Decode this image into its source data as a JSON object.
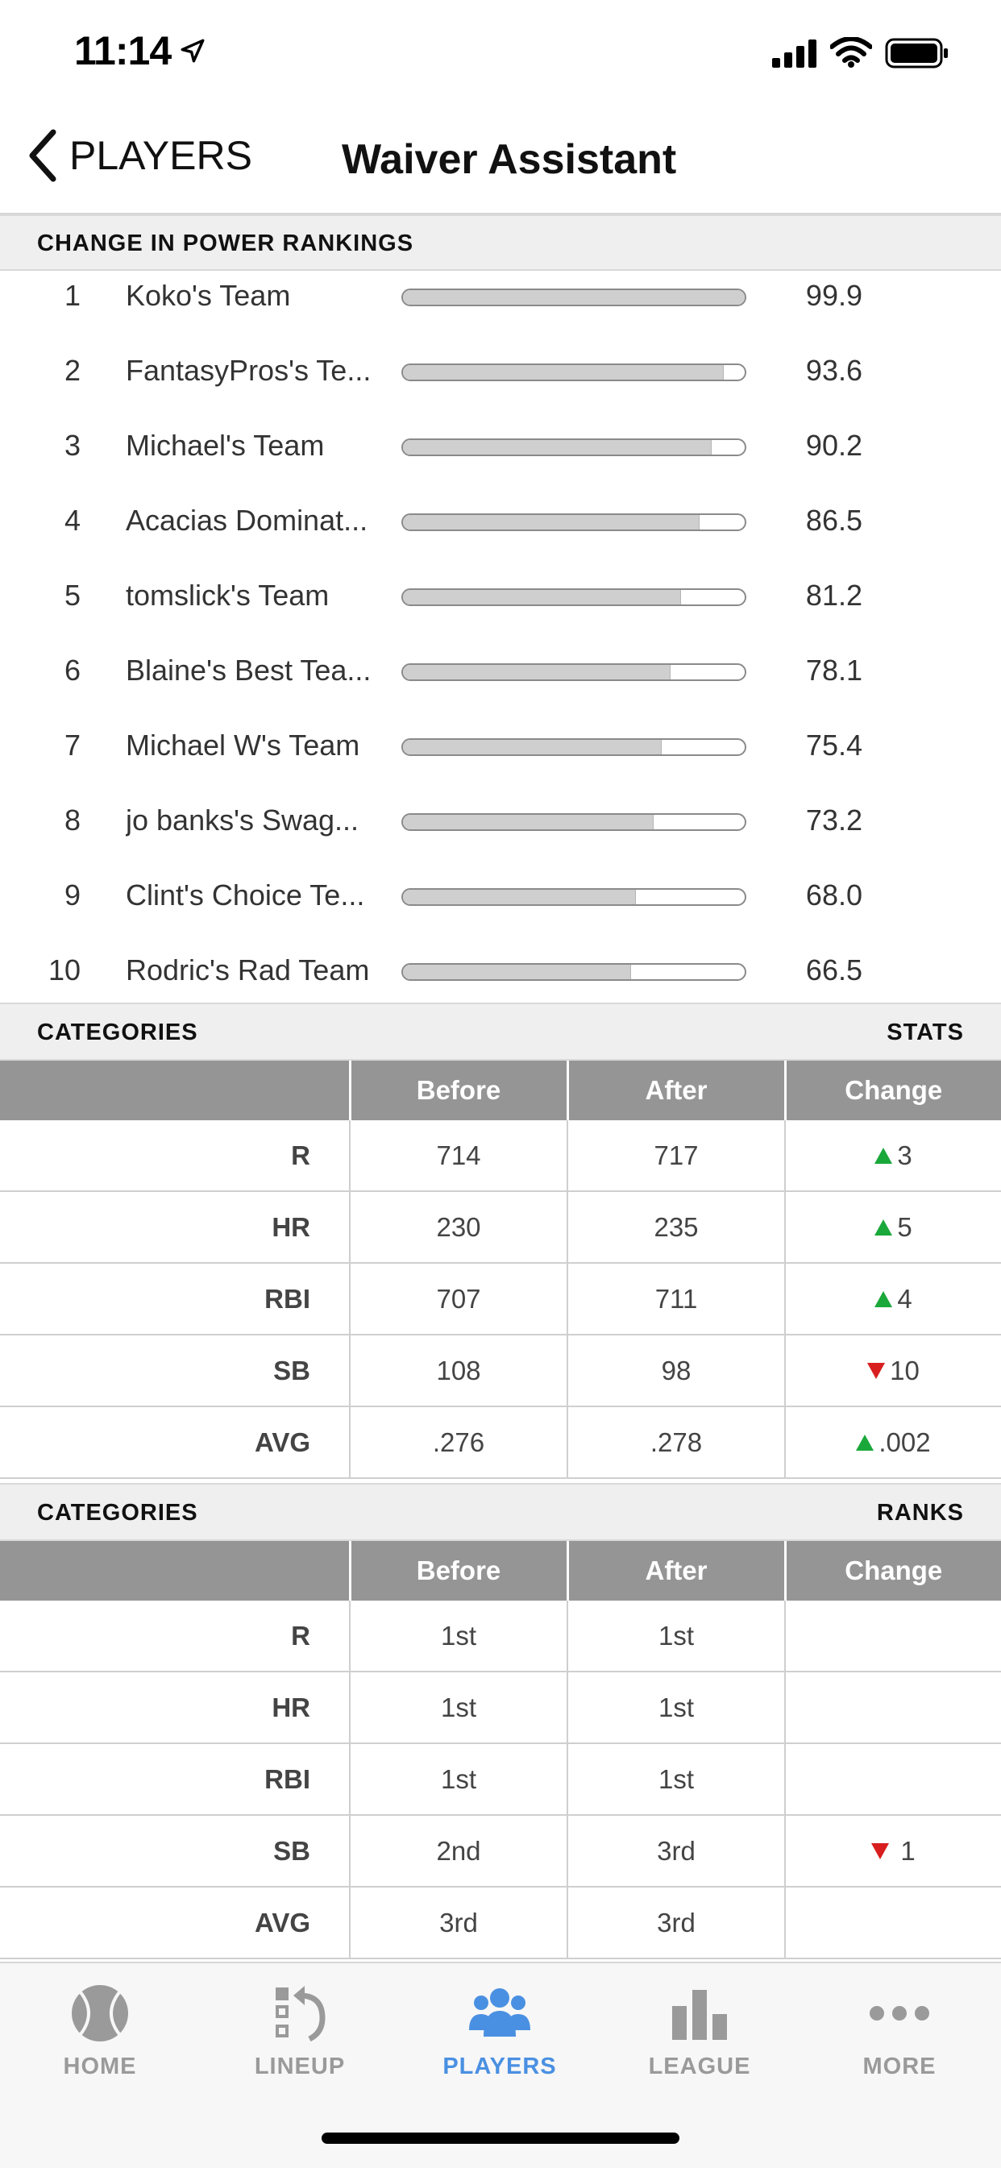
{
  "status_bar": {
    "time": "11:14"
  },
  "nav": {
    "back_label": "PLAYERS",
    "title": "Waiver Assistant"
  },
  "power_rankings": {
    "header": "CHANGE IN POWER RANKINGS",
    "teams": [
      {
        "rank": "1",
        "name": "Koko's Team",
        "score": "99.9",
        "fill": 0.999
      },
      {
        "rank": "2",
        "name": "FantasyPros's Te...",
        "score": "93.6",
        "fill": 0.936
      },
      {
        "rank": "3",
        "name": "Michael's Team",
        "score": "90.2",
        "fill": 0.902
      },
      {
        "rank": "4",
        "name": "Acacias Dominat...",
        "score": "86.5",
        "fill": 0.865
      },
      {
        "rank": "5",
        "name": "tomslick's Team",
        "score": "81.2",
        "fill": 0.812
      },
      {
        "rank": "6",
        "name": "Blaine's Best Tea...",
        "score": "78.1",
        "fill": 0.781
      },
      {
        "rank": "7",
        "name": "Michael W's Team",
        "score": "75.4",
        "fill": 0.754
      },
      {
        "rank": "8",
        "name": "jo banks's Swag...",
        "score": "73.2",
        "fill": 0.732
      },
      {
        "rank": "9",
        "name": "Clint's Choice Te...",
        "score": "68.0",
        "fill": 0.68
      },
      {
        "rank": "10",
        "name": "Rodric's Rad Team",
        "score": "66.5",
        "fill": 0.665
      }
    ]
  },
  "stats_section": {
    "header_left": "CATEGORIES",
    "header_right": "STATS",
    "columns": [
      "",
      "Before",
      "After",
      "Change"
    ],
    "rows": [
      {
        "cat": "R",
        "before": "714",
        "after": "717",
        "change": "3",
        "dir": "up"
      },
      {
        "cat": "HR",
        "before": "230",
        "after": "235",
        "change": "5",
        "dir": "up"
      },
      {
        "cat": "RBI",
        "before": "707",
        "after": "711",
        "change": "4",
        "dir": "up"
      },
      {
        "cat": "SB",
        "before": "108",
        "after": "98",
        "change": "10",
        "dir": "down"
      },
      {
        "cat": "AVG",
        "before": ".276",
        "after": ".278",
        "change": ".002",
        "dir": "up"
      }
    ]
  },
  "ranks_section": {
    "header_left": "CATEGORIES",
    "header_right": "RANKS",
    "columns": [
      "",
      "Before",
      "After",
      "Change"
    ],
    "rows": [
      {
        "cat": "R",
        "before": "1st",
        "after": "1st",
        "change": "",
        "dir": ""
      },
      {
        "cat": "HR",
        "before": "1st",
        "after": "1st",
        "change": "",
        "dir": ""
      },
      {
        "cat": "RBI",
        "before": "1st",
        "after": "1st",
        "change": "",
        "dir": ""
      },
      {
        "cat": "SB",
        "before": "2nd",
        "after": "3rd",
        "change": "1",
        "dir": "down"
      },
      {
        "cat": "AVG",
        "before": "3rd",
        "after": "3rd",
        "change": "",
        "dir": ""
      }
    ]
  },
  "tab_bar": {
    "active": "players",
    "tabs": [
      {
        "id": "home",
        "label": "HOME",
        "icon": "baseball-icon"
      },
      {
        "id": "lineup",
        "label": "LINEUP",
        "icon": "lineup-icon"
      },
      {
        "id": "players",
        "label": "PLAYERS",
        "icon": "players-icon"
      },
      {
        "id": "league",
        "label": "LEAGUE",
        "icon": "bar-chart-icon"
      },
      {
        "id": "more",
        "label": "MORE",
        "icon": "ellipsis-icon"
      }
    ]
  },
  "colors": {
    "accent": "#4a90e2",
    "up": "#1aa83a",
    "down": "#d81e1e",
    "table_header": "#959595"
  }
}
